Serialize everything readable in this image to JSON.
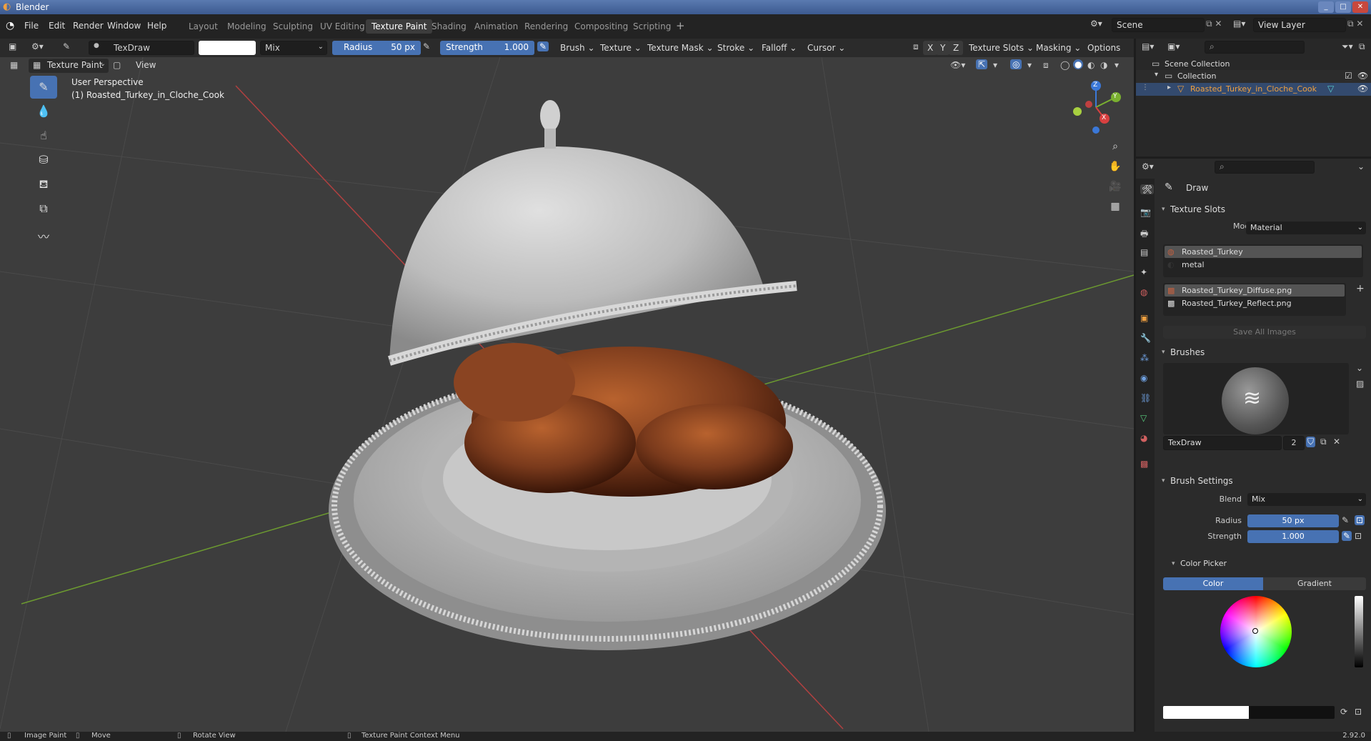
{
  "app": {
    "title": "Blender",
    "version": "2.92.0"
  },
  "menus": [
    "File",
    "Edit",
    "Render",
    "Window",
    "Help"
  ],
  "workspaces": [
    "Layout",
    "Modeling",
    "Sculpting",
    "UV Editing",
    "Texture Paint",
    "Shading",
    "Animation",
    "Rendering",
    "Compositing",
    "Scripting"
  ],
  "active_workspace": "Texture Paint",
  "scene": {
    "name": "Scene",
    "view_layer": "View Layer"
  },
  "tool_header": {
    "brush_name": "TexDraw",
    "blend": "Mix",
    "radius_label": "Radius",
    "radius_value": "50 px",
    "strength_label": "Strength",
    "strength_value": "1.000",
    "menus": [
      "Brush",
      "Texture",
      "Texture Mask",
      "Stroke",
      "Falloff",
      "Cursor"
    ],
    "axes": [
      "X",
      "Y",
      "Z"
    ],
    "right_menus": [
      "Texture Slots",
      "Masking",
      "Options"
    ]
  },
  "viewport_header": {
    "mode": "Texture Paint",
    "view": "View"
  },
  "viewport": {
    "perspective": "User Perspective",
    "object": "(1) Roasted_Turkey_in_Cloche_Cook"
  },
  "gizmo": {
    "x": "X",
    "y": "Y",
    "z": "Z"
  },
  "outliner": {
    "scene_collection": "Scene Collection",
    "collection": "Collection",
    "object": "Roasted_Turkey_in_Cloche_Cook"
  },
  "properties": {
    "tool_name": "Draw",
    "texture_slots": {
      "title": "Texture Slots",
      "mode_label": "Mode",
      "mode_value": "Material",
      "materials": [
        "Roasted_Turkey",
        "metal"
      ],
      "images": [
        "Roasted_Turkey_Diffuse.png",
        "Roasted_Turkey_Reflect.png"
      ],
      "save_all": "Save All Images"
    },
    "brushes": {
      "title": "Brushes",
      "name": "TexDraw",
      "users": "2"
    },
    "brush_settings": {
      "title": "Brush Settings",
      "blend_label": "Blend",
      "blend_value": "Mix",
      "radius_label": "Radius",
      "radius_value": "50 px",
      "strength_label": "Strength",
      "strength_value": "1.000"
    },
    "color_picker": {
      "title": "Color Picker",
      "tab_color": "Color",
      "tab_gradient": "Gradient"
    }
  },
  "statusbar": {
    "left": "Image Paint",
    "move": "Move",
    "rotate": "Rotate View",
    "context": "Texture Paint Context Menu"
  },
  "colors": {
    "accent": "#4772b3",
    "turkey": "#7a3a1c",
    "cloche": "#c8c8c8",
    "grid_x": "#b04040",
    "grid_y": "#6c9a30"
  }
}
